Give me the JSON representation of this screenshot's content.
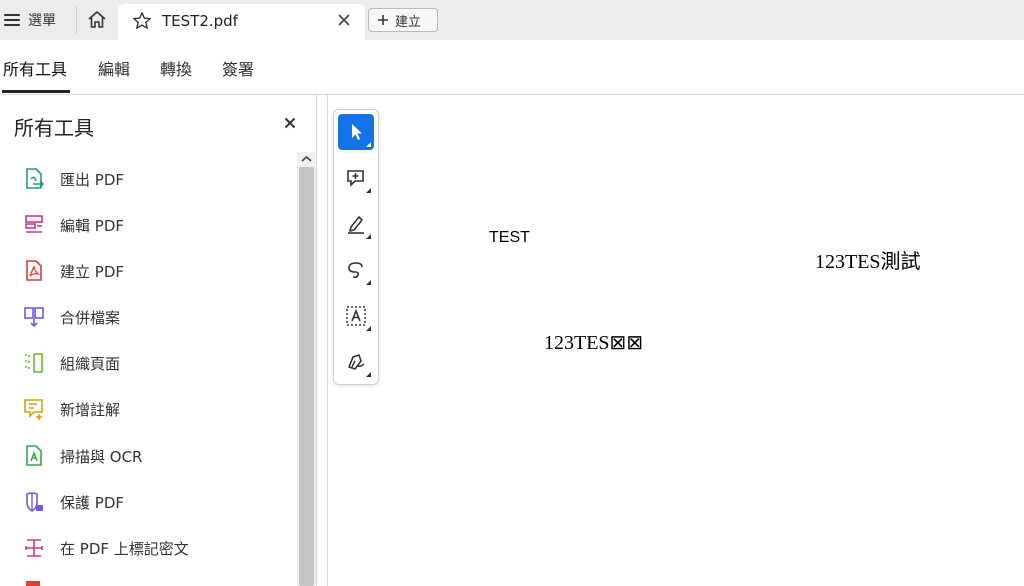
{
  "tabbar": {
    "menu_label": "選單",
    "document_tab_title": "TEST2.pdf",
    "new_label": "建立"
  },
  "tool_tabs": [
    {
      "label": "所有工具",
      "active": true
    },
    {
      "label": "編輯",
      "active": false
    },
    {
      "label": "轉換",
      "active": false
    },
    {
      "label": "簽署",
      "active": false
    }
  ],
  "panel": {
    "title": "所有工具",
    "items": [
      {
        "label": "匯出 PDF",
        "icon": "export-pdf-icon",
        "color": "#1f9c8c"
      },
      {
        "label": "編輯 PDF",
        "icon": "edit-pdf-icon",
        "color": "#d6338a"
      },
      {
        "label": "建立 PDF",
        "icon": "create-pdf-icon",
        "color": "#e03a3a"
      },
      {
        "label": "合併檔案",
        "icon": "combine-files-icon",
        "color": "#6b5ce7"
      },
      {
        "label": "組織頁面",
        "icon": "organize-pages-icon",
        "color": "#6cbf2a"
      },
      {
        "label": "新增註解",
        "icon": "add-comment-icon",
        "color": "#d9a400"
      },
      {
        "label": "掃描與 OCR",
        "icon": "scan-ocr-icon",
        "color": "#3aa64a"
      },
      {
        "label": "保護 PDF",
        "icon": "protect-pdf-icon",
        "color": "#6b5ce7"
      },
      {
        "label": "在 PDF 上標記密文",
        "icon": "redact-icon",
        "color": "#d6338a"
      }
    ]
  },
  "document": {
    "text_1": "TEST",
    "text_2": "123TES測試",
    "text_3": "123TES⊠⊠"
  },
  "quick_tools": [
    "select-icon",
    "add-comment-icon",
    "highlight-icon",
    "draw-icon",
    "text-recognize-icon",
    "sign-icon"
  ],
  "colors": {
    "accent": "#1473e6"
  }
}
